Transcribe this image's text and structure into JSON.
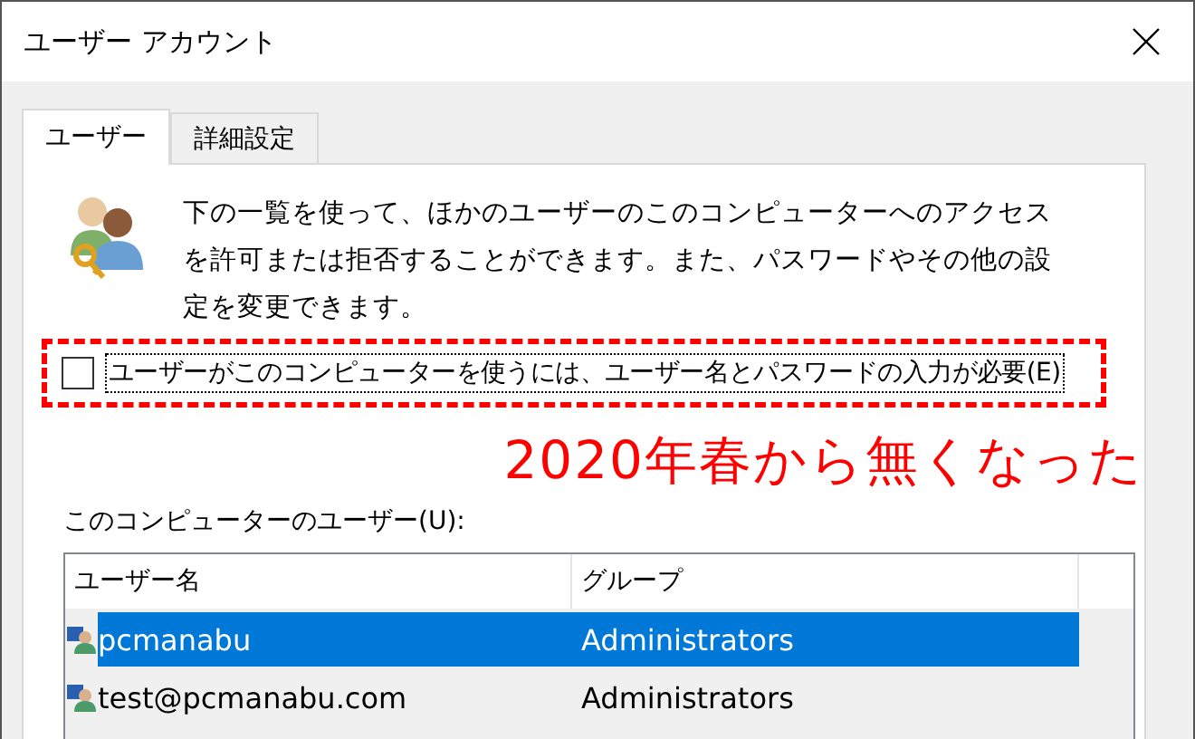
{
  "window": {
    "title": "ユーザー アカウント"
  },
  "tabs": [
    {
      "label": "ユーザー",
      "selected": true
    },
    {
      "label": "詳細設定",
      "selected": false
    }
  ],
  "description": "下の一覧を使って、ほかのユーザーのこのコンピューターへのアクセスを許可または拒否することができます。また、パスワードやその他の設定を変更できます。",
  "require_login": {
    "label": "ユーザーがこのコンピューターを使うには、ユーザー名とパスワードの入力が必要(E)",
    "checked": false
  },
  "annotation": "2020年春から無くなった",
  "users_label": "このコンピューターのユーザー(U):",
  "table": {
    "columns": [
      "ユーザー名",
      "グループ"
    ],
    "rows": [
      {
        "name": "pcmanabu",
        "group": "Administrators",
        "selected": true
      },
      {
        "name": "test@pcmanabu.com",
        "group": "Administrators",
        "selected": false
      }
    ]
  }
}
